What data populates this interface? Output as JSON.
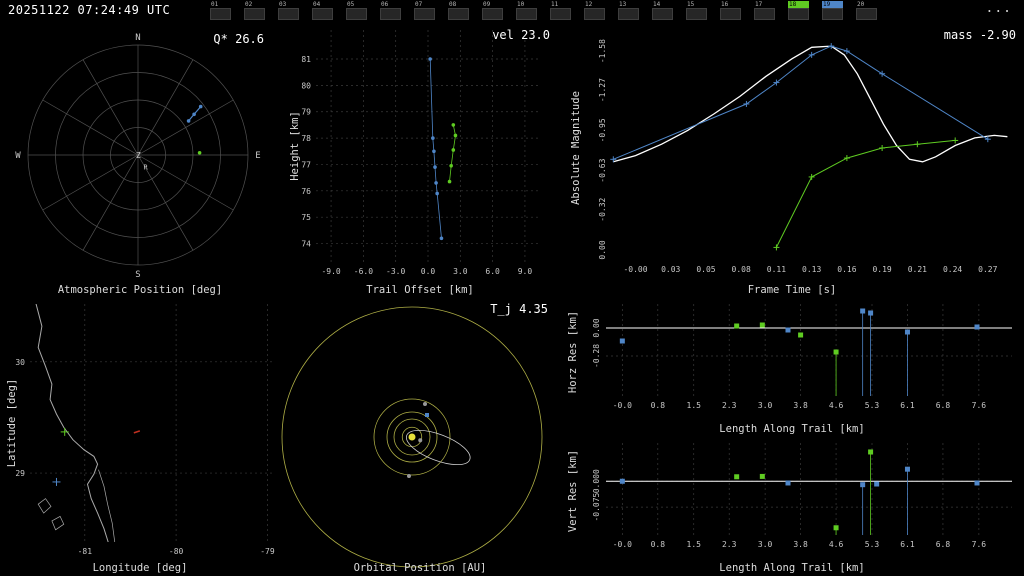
{
  "colors": {
    "background": "#000000",
    "text": "#ffffff",
    "tick": "#c8c8c8",
    "grid": "#3a3a3a",
    "polar_grid": "#525252",
    "blue": "#4f86c8",
    "green": "#5fcc22",
    "white": "#ffffff",
    "yellow": "#b0b046",
    "sun": "#e8e13a",
    "gray": "#999999",
    "coast": "#aaaaaa",
    "red": "#c03020"
  },
  "header": {
    "timestamp": "20251122 07:24:49 UTC",
    "menu": "...",
    "frames": [
      "01",
      "02",
      "03",
      "04",
      "05",
      "06",
      "07",
      "08",
      "09",
      "10",
      "11",
      "12",
      "13",
      "14",
      "15",
      "16",
      "17",
      "18",
      "19",
      "20"
    ],
    "highlight_green": "18",
    "highlight_blue": "19"
  },
  "chart_data": [
    {
      "render": "polar",
      "type": "scatter",
      "corner_label": "Q* 26.6",
      "xlabel": "Atmospheric Position [deg]",
      "compass": {
        "n": "N",
        "e": "E",
        "s": "S",
        "w": "W",
        "center": "Z",
        "radiant": "R"
      },
      "rings": 4,
      "spoke_step_deg": 30,
      "radiant_frac": [
        0.05,
        0.13
      ],
      "series": [
        {
          "name": "station-1-track",
          "color": "blue",
          "marker": "dot",
          "line": true,
          "points_frac": [
            [
              0.46,
              -0.31
            ],
            [
              0.51,
              -0.37
            ],
            [
              0.57,
              -0.44
            ]
          ]
        },
        {
          "name": "station-2-track",
          "color": "green",
          "marker": "dot",
          "line": false,
          "points_frac": [
            [
              0.56,
              -0.02
            ]
          ]
        }
      ]
    },
    {
      "render": "xy",
      "type": "scatter",
      "corner_label": "vel 23.0",
      "xlabel": "Trail Offset [km]",
      "ylabel": "Height [km]",
      "xlim": [
        -10.4,
        10.4
      ],
      "ylim": [
        73.3,
        82.1
      ],
      "xticks": [
        -9,
        -6,
        -3,
        0,
        3,
        6,
        9
      ],
      "xtick_labels": [
        "-9.0",
        "-6.0",
        "-3.0",
        "0.0",
        "3.0",
        "6.0",
        "9.0"
      ],
      "yticks": [
        74,
        75,
        76,
        77,
        78,
        79,
        80,
        81
      ],
      "ytick_labels": [
        "74",
        "75",
        "76",
        "77",
        "78",
        "79",
        "80",
        "81"
      ],
      "grid": true,
      "series": [
        {
          "name": "station-1-trail",
          "color": "blue",
          "marker": "dot",
          "line": true,
          "width": 0.8,
          "points": [
            [
              0.2,
              81.0
            ],
            [
              0.45,
              78.0
            ],
            [
              0.55,
              77.5
            ],
            [
              0.65,
              76.9
            ],
            [
              0.75,
              76.3
            ],
            [
              0.85,
              75.9
            ],
            [
              1.25,
              74.2
            ]
          ]
        },
        {
          "name": "station-2-trail",
          "color": "green",
          "marker": "dot",
          "line": true,
          "width": 0.8,
          "points": [
            [
              2.35,
              78.5
            ],
            [
              2.55,
              78.1
            ],
            [
              2.35,
              77.55
            ],
            [
              2.15,
              76.95
            ],
            [
              2.0,
              76.35
            ]
          ]
        }
      ]
    },
    {
      "render": "xy",
      "type": "line",
      "corner_label": "mass -2.90",
      "xlabel": "Frame Time [s]",
      "ylabel": "Absolute Magnitude",
      "xlim": [
        -0.018,
        0.287
      ],
      "ylim": [
        0.08,
        -1.7
      ],
      "xticks": [
        0,
        0.027,
        0.054,
        0.081,
        0.108,
        0.135,
        0.162,
        0.189,
        0.216,
        0.243,
        0.27
      ],
      "xtick_labels": [
        "-0.00",
        "0.03",
        "0.05",
        "0.08",
        "0.11",
        "0.13",
        "0.16",
        "0.19",
        "0.21",
        "0.24",
        "0.27"
      ],
      "yticks": [
        -1.58,
        -1.27,
        -0.95,
        -0.63,
        -0.32,
        0
      ],
      "ytick_labels": [
        "-1.58",
        "-1.27",
        "-0.95",
        "-0.63",
        "-0.32",
        "0.00"
      ],
      "ytick_rotate": true,
      "grid": false,
      "series": [
        {
          "name": "model-light-curve",
          "color": "white",
          "marker": null,
          "line": true,
          "width": 1.3,
          "points": [
            [
              -0.017,
              -0.7
            ],
            [
              0,
              -0.75
            ],
            [
              0.02,
              -0.84
            ],
            [
              0.04,
              -0.95
            ],
            [
              0.06,
              -1.08
            ],
            [
              0.08,
              -1.22
            ],
            [
              0.1,
              -1.38
            ],
            [
              0.12,
              -1.52
            ],
            [
              0.135,
              -1.61
            ],
            [
              0.15,
              -1.62
            ],
            [
              0.16,
              -1.55
            ],
            [
              0.17,
              -1.4
            ],
            [
              0.18,
              -1.2
            ],
            [
              0.19,
              -1.0
            ],
            [
              0.2,
              -0.83
            ],
            [
              0.21,
              -0.72
            ],
            [
              0.22,
              -0.7
            ],
            [
              0.23,
              -0.74
            ],
            [
              0.245,
              -0.83
            ],
            [
              0.26,
              -0.89
            ],
            [
              0.275,
              -0.91
            ],
            [
              0.285,
              -0.9
            ]
          ]
        },
        {
          "name": "station-1-light-curve",
          "color": "blue",
          "marker": "plus",
          "line": true,
          "width": 1,
          "points": [
            [
              -0.017,
              -0.72
            ],
            [
              0.085,
              -1.16
            ],
            [
              0.108,
              -1.33
            ],
            [
              0.135,
              -1.55
            ],
            [
              0.15,
              -1.62
            ],
            [
              0.162,
              -1.58
            ],
            [
              0.189,
              -1.4
            ],
            [
              0.27,
              -0.88
            ]
          ]
        },
        {
          "name": "station-2-light-curve",
          "color": "green",
          "marker": "plus",
          "line": true,
          "width": 1,
          "points": [
            [
              0.108,
              -0.02
            ],
            [
              0.135,
              -0.58
            ],
            [
              0.162,
              -0.73
            ],
            [
              0.189,
              -0.81
            ],
            [
              0.216,
              -0.84
            ],
            [
              0.245,
              -0.87
            ]
          ]
        }
      ]
    },
    {
      "render": "map",
      "type": "scatter",
      "xlabel": "Longitude [deg]",
      "ylabel": "Latitude [deg]",
      "xlim": [
        -81.6,
        -78.95
      ],
      "ylim": [
        28.38,
        30.52
      ],
      "xticks": [
        -81,
        -80,
        -79
      ],
      "xtick_labels": [
        "-81",
        "-80",
        "-79"
      ],
      "yticks": [
        29,
        30
      ],
      "ytick_labels": [
        "29",
        "30"
      ],
      "grid": true,
      "coastline": [
        [
          -81.55,
          30.57
        ],
        [
          -81.47,
          30.32
        ],
        [
          -81.51,
          30.13
        ],
        [
          -81.43,
          29.96
        ],
        [
          -81.36,
          29.8
        ],
        [
          -81.38,
          29.66
        ],
        [
          -81.31,
          29.53
        ],
        [
          -81.23,
          29.41
        ],
        [
          -81.13,
          29.3
        ],
        [
          -81.01,
          29.21
        ],
        [
          -80.9,
          29.15
        ],
        [
          -80.86,
          29.08
        ],
        [
          -80.9,
          28.99
        ],
        [
          -80.97,
          28.9
        ],
        [
          -80.93,
          28.77
        ],
        [
          -80.86,
          28.64
        ],
        [
          -80.79,
          28.5
        ],
        [
          -80.74,
          28.37
        ],
        [
          -80.7,
          28.26
        ]
      ],
      "lagoon": [
        [
          -80.85,
          29.03
        ],
        [
          -80.79,
          28.88
        ],
        [
          -80.75,
          28.72
        ],
        [
          -80.7,
          28.55
        ],
        [
          -80.67,
          28.37
        ]
      ],
      "islands": [
        [
          [
            -81.51,
            28.72
          ],
          [
            -81.43,
            28.77
          ],
          [
            -81.37,
            28.7
          ],
          [
            -81.45,
            28.64
          ]
        ],
        [
          [
            -81.36,
            28.57
          ],
          [
            -81.27,
            28.61
          ],
          [
            -81.23,
            28.54
          ],
          [
            -81.32,
            28.49
          ]
        ]
      ],
      "markers": [
        {
          "name": "begin-point",
          "lon": -81.22,
          "lat": 29.37,
          "c": "green",
          "shape": "plus"
        },
        {
          "name": "end-point",
          "lon": -81.31,
          "lat": 28.92,
          "c": "blue",
          "shape": "plus"
        },
        {
          "name": "reference-point",
          "lon": -80.43,
          "lat": 29.37,
          "c": "red",
          "shape": "dash"
        }
      ]
    },
    {
      "render": "orbit",
      "type": "line",
      "corner_label": "T_j 4.35",
      "xlabel": "Orbital Position [AU]",
      "planet_orbits_au": [
        0.39,
        0.72,
        1.0,
        1.52,
        5.2
      ],
      "planets": [
        {
          "x": 0.52,
          "y": -1.32
        },
        {
          "x": -0.12,
          "y": 1.56
        },
        {
          "x": 0.33,
          "y": 0.13
        }
      ],
      "earth": {
        "x": 0.6,
        "y": -0.88
      },
      "meteoroid_orbit": {
        "cx": 1.05,
        "cy": 0.42,
        "rx": 1.35,
        "ry": 0.52,
        "rot_deg": 21
      }
    },
    {
      "render": "res",
      "type": "scatter",
      "xlabel": "Length Along Trail [km]",
      "ylabel": "Horz Res [km]",
      "xlim": [
        -0.35,
        8.35
      ],
      "ylim": [
        -0.68,
        0.24
      ],
      "xticks": [
        0,
        0.76,
        1.53,
        2.29,
        3.06,
        3.82,
        4.58,
        5.35,
        6.11,
        6.87,
        7.64
      ],
      "xtick_labels": [
        "-0.0",
        "0.8",
        "1.5",
        "2.3",
        "3.0",
        "3.8",
        "4.6",
        "5.3",
        "6.1",
        "6.8",
        "7.6"
      ],
      "yticks": [
        0,
        -0.28
      ],
      "ytick_labels": [
        "0.00",
        "-0.28"
      ],
      "ytick_rotate": true,
      "grid": true,
      "zero_line": true,
      "points": [
        {
          "x": 0,
          "y": -0.13,
          "c": "blue"
        },
        {
          "x": 2.45,
          "y": 0.02,
          "c": "green"
        },
        {
          "x": 3.0,
          "y": 0.03,
          "c": "green"
        },
        {
          "x": 3.55,
          "y": -0.02,
          "c": "blue"
        },
        {
          "x": 3.82,
          "y": -0.07,
          "c": "green"
        },
        {
          "x": 4.58,
          "y": -0.24,
          "c": "green",
          "stem": true
        },
        {
          "x": 5.15,
          "y": 0.17,
          "c": "blue",
          "stem": true
        },
        {
          "x": 5.32,
          "y": 0.15,
          "c": "blue",
          "stem": true
        },
        {
          "x": 6.11,
          "y": -0.04,
          "c": "blue",
          "stem": true
        },
        {
          "x": 7.6,
          "y": 0.01,
          "c": "blue"
        }
      ]
    },
    {
      "render": "res",
      "type": "scatter",
      "xlabel": "Length Along Trail [km]",
      "ylabel": "Vert Res [km]",
      "xlim": [
        -0.35,
        8.35
      ],
      "ylim": [
        -0.156,
        0.111
      ],
      "xticks": [
        0,
        0.76,
        1.53,
        2.29,
        3.06,
        3.82,
        4.58,
        5.35,
        6.11,
        6.87,
        7.64
      ],
      "xtick_labels": [
        "-0.0",
        "0.8",
        "1.5",
        "2.3",
        "3.0",
        "3.8",
        "4.6",
        "5.3",
        "6.1",
        "6.8",
        "7.6"
      ],
      "yticks": [
        0,
        -0.075
      ],
      "ytick_labels": [
        "0.000",
        "-0.075"
      ],
      "ytick_rotate": true,
      "grid": true,
      "zero_line": true,
      "points": [
        {
          "x": 0,
          "y": 0.0,
          "c": "blue"
        },
        {
          "x": 2.45,
          "y": 0.013,
          "c": "green"
        },
        {
          "x": 3.0,
          "y": 0.014,
          "c": "green"
        },
        {
          "x": 3.55,
          "y": -0.005,
          "c": "blue"
        },
        {
          "x": 4.58,
          "y": -0.135,
          "c": "green",
          "stem": true
        },
        {
          "x": 5.15,
          "y": -0.01,
          "c": "blue",
          "stem": true
        },
        {
          "x": 5.32,
          "y": 0.085,
          "c": "green",
          "stem": true
        },
        {
          "x": 5.45,
          "y": -0.008,
          "c": "blue"
        },
        {
          "x": 6.11,
          "y": 0.035,
          "c": "blue",
          "stem": true
        },
        {
          "x": 7.6,
          "y": -0.005,
          "c": "blue"
        }
      ]
    }
  ]
}
